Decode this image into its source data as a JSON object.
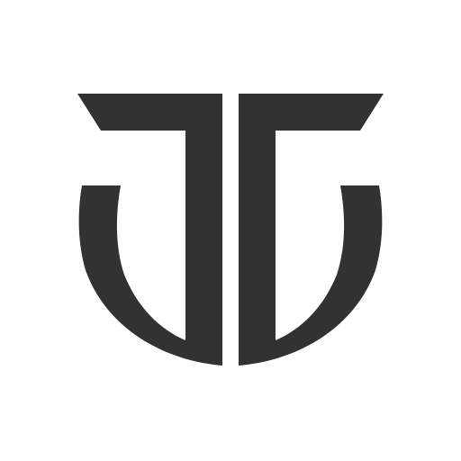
{
  "logo": {
    "icon": "monogram-logo-icon",
    "fill_color": "#333233",
    "background_color": "#ffffff"
  }
}
